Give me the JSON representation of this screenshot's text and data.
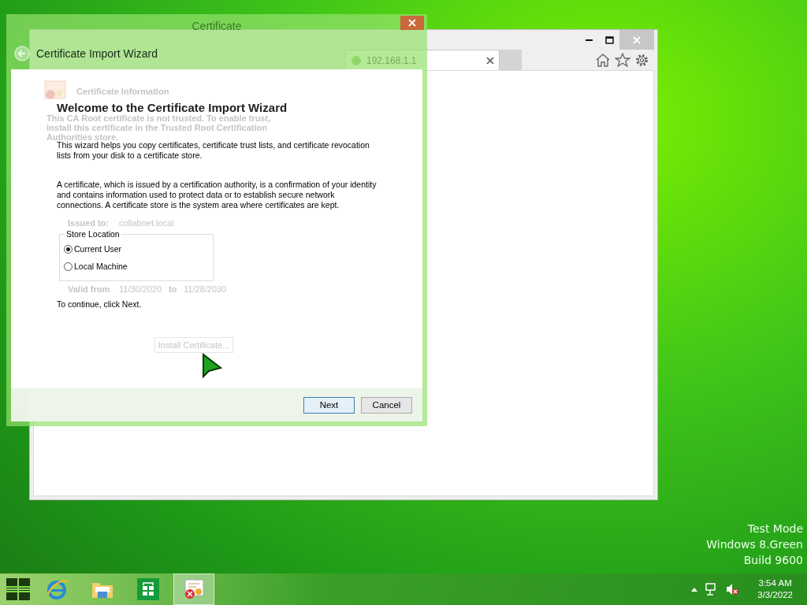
{
  "browser": {
    "tab_title": "192.168.1.1"
  },
  "background_dialog": {
    "title": "Certificate",
    "section": "Certificate Information",
    "warning": "This CA Root certificate is not trusted. To enable trust, install this certificate in the Trusted Root Certification Authorities store.",
    "issued_to_label": "Issued to:",
    "issued_to": "collabnet.local",
    "valid_from_label": "Valid from",
    "valid_from": "11/30/2020",
    "to_label": "to",
    "valid_to": "11/28/2030",
    "install_button": "Install Certificate..."
  },
  "wizard": {
    "title": "Certificate Import Wizard",
    "heading": "Welcome to the Certificate Import Wizard",
    "paragraphs": [
      "This wizard helps you copy certificates, certificate trust lists, and certificate revocation lists from your disk to a certificate store.",
      "A certificate, which is issued by a certification authority, is a confirmation of your identity and contains information used to protect data or to establish secure network connections. A certificate store is the system area where certificates are kept."
    ],
    "store_location": {
      "label": "Store Location",
      "options": [
        {
          "label": "Current User",
          "selected": true
        },
        {
          "label": "Local Machine",
          "selected": false
        }
      ]
    },
    "footer_text": "To continue, click Next.",
    "buttons": [
      {
        "label": "Next",
        "default": true
      },
      {
        "label": "Cancel",
        "default": false
      }
    ]
  },
  "desktop_text": [
    "Test Mode",
    "Windows 8.Green",
    "Build 9600"
  ],
  "taskbar": {
    "apps": [
      {
        "kind": "browser",
        "active": false
      },
      {
        "kind": "files",
        "active": false
      },
      {
        "kind": "store",
        "active": false
      },
      {
        "kind": "certificate",
        "active": true
      }
    ],
    "time": "3:54 AM",
    "date": "3/3/2022"
  }
}
